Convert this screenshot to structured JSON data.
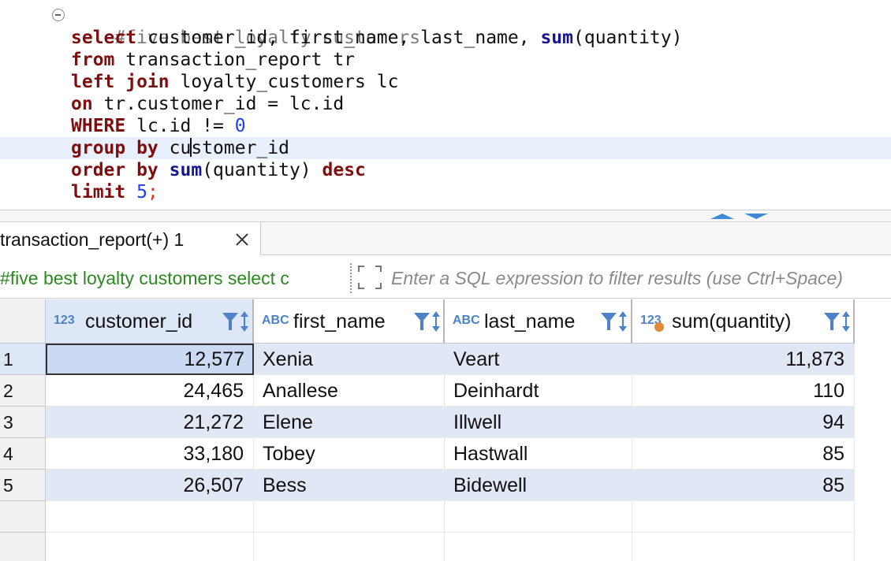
{
  "editor": {
    "comment": "#five best loyalty customers",
    "lines": [
      {
        "kw1": "select",
        "t1": " customer_id, first_name, last_name, ",
        "fn": "sum",
        "t2": "(quantity)"
      },
      {
        "kw1": "from",
        "t1": " transaction_report tr"
      },
      {
        "kw1": "left join",
        "t1": " loyalty_customers lc"
      },
      {
        "kw1": "on",
        "t1": " tr.customer_id = lc.id"
      },
      {
        "kw1": "WHERE",
        "t1": " lc.id != ",
        "num": "0"
      },
      {
        "kw1": "group by",
        "t1a": " cu",
        "t1b": "stomer_id"
      },
      {
        "kw1": "order by",
        "fn": "sum",
        "t1": "(quantity) ",
        "kw2": "desc"
      },
      {
        "kw1": "limit",
        "num": "5",
        "semi": ";"
      }
    ]
  },
  "result_tab": {
    "label": "transaction_report(+) 1"
  },
  "filter_bar": {
    "query_label": "#five best loyalty customers select c",
    "placeholder": "Enter a SQL expression to filter results (use Ctrl+Space)"
  },
  "grid": {
    "columns": [
      {
        "type": "123",
        "name": "customer_id"
      },
      {
        "type": "ABC",
        "name": "first_name"
      },
      {
        "type": "ABC",
        "name": "last_name"
      },
      {
        "type": "123",
        "name": "sum(quantity)"
      }
    ],
    "rows": [
      {
        "n": "1",
        "customer_id": "12,577",
        "first_name": "Xenia",
        "last_name": "Veart",
        "sum_quantity": "11,873"
      },
      {
        "n": "2",
        "customer_id": "24,465",
        "first_name": "Anallese",
        "last_name": "Deinhardt",
        "sum_quantity": "110"
      },
      {
        "n": "3",
        "customer_id": "21,272",
        "first_name": "Elene",
        "last_name": "Illwell",
        "sum_quantity": "94"
      },
      {
        "n": "4",
        "customer_id": "33,180",
        "first_name": "Tobey",
        "last_name": "Hastwall",
        "sum_quantity": "85"
      },
      {
        "n": "5",
        "customer_id": "26,507",
        "first_name": "Bess",
        "last_name": "Bidewell",
        "sum_quantity": "85"
      }
    ]
  },
  "colors": {
    "keyword": "#7f0e0e",
    "function": "#15168f",
    "number": "#1d3ef5",
    "query_label": "#2b8a1f",
    "row_stripe": "#dfe8f4"
  }
}
